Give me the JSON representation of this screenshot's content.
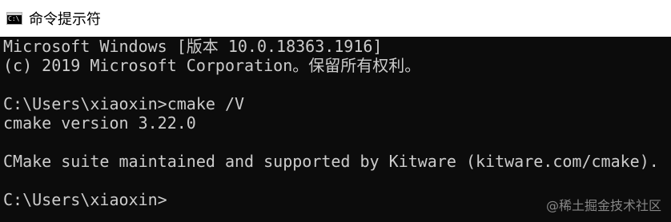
{
  "window": {
    "title": "命令提示符",
    "icon": "console-icon",
    "icon_glyph": "C:\\",
    "background_color": "#0c0c0c",
    "text_color": "#cccccc"
  },
  "console": {
    "lines": [
      "Microsoft Windows [版本 10.0.18363.1916]",
      "(c) 2019 Microsoft Corporation。保留所有权利。",
      "",
      "C:\\Users\\xiaoxin>cmake /V",
      "cmake version 3.22.0",
      "",
      "CMake suite maintained and supported by Kitware (kitware.com/cmake).",
      "",
      "C:\\Users\\xiaoxin>"
    ]
  },
  "watermark": {
    "text": "@稀土掘金技术社区"
  }
}
